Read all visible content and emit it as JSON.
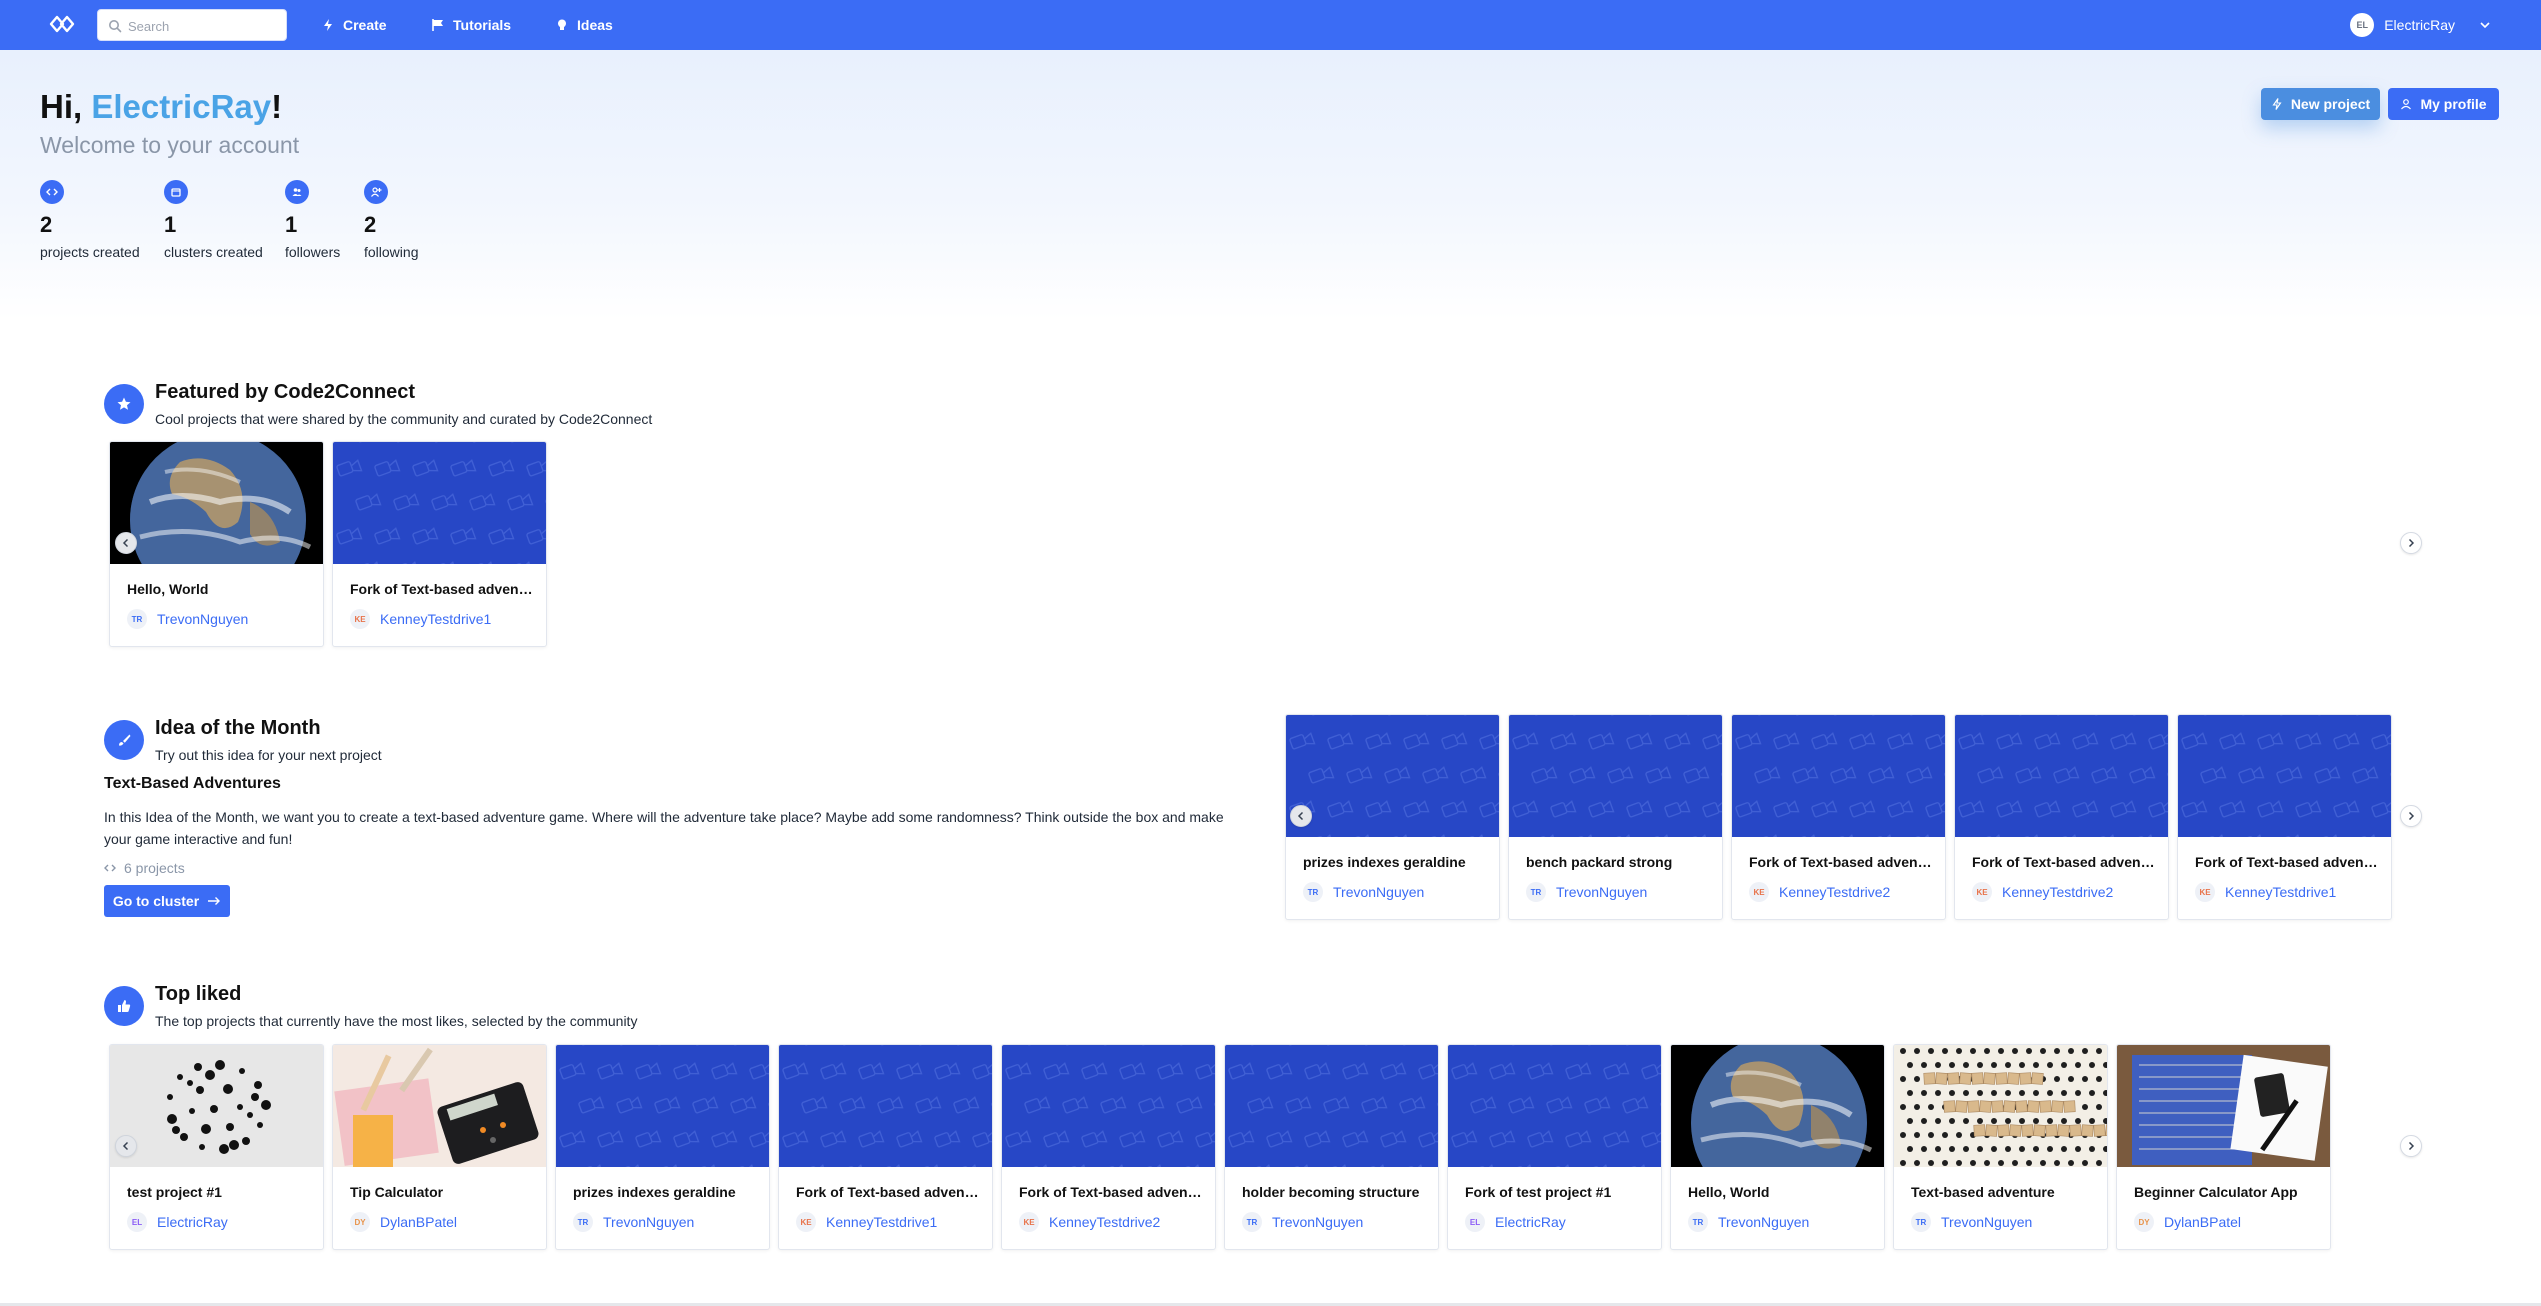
{
  "nav": {
    "search_placeholder": "Search",
    "links": [
      {
        "label": "Create",
        "icon": "bolt-icon"
      },
      {
        "label": "Tutorials",
        "icon": "flag-icon"
      },
      {
        "label": "Ideas",
        "icon": "lightbulb-icon"
      }
    ],
    "user": {
      "initials": "EL",
      "name": "ElectricRay"
    }
  },
  "hero": {
    "greeting_prefix": "Hi, ",
    "username": "ElectricRay",
    "greeting_suffix": "!",
    "welcome": "Welcome to your account",
    "stats": [
      {
        "value": "2",
        "label": "projects created",
        "icon": "code-icon"
      },
      {
        "value": "1",
        "label": "clusters created",
        "icon": "folder-icon"
      },
      {
        "value": "1",
        "label": "followers",
        "icon": "users-icon"
      },
      {
        "value": "2",
        "label": "following",
        "icon": "user-plus-icon"
      }
    ],
    "new_project_label": "New project",
    "my_profile_label": "My profile"
  },
  "featured": {
    "title": "Featured by Code2Connect",
    "subtitle": "Cool projects that were shared by the community and curated by Code2Connect",
    "cards": [
      {
        "title": "Hello, World",
        "initials": "TR",
        "author": "TrevonNguyen",
        "thumb": "earth"
      },
      {
        "title": "Fork of Text-based adventure",
        "initials": "KE",
        "author": "KenneyTestdrive1",
        "thumb": "pattern"
      }
    ]
  },
  "idea": {
    "title": "Idea of the Month",
    "subtitle": "Try out this idea for your next project",
    "idea_title": "Text-Based Adventures",
    "description": "In this Idea of the Month, we want you to create a text-based adventure game. Where will the adventure take place? Maybe add some randomness? Think outside the box and make your game interactive and fun!",
    "count": "6 projects",
    "button_label": "Go to cluster",
    "cards": [
      {
        "title": "prizes indexes geraldine",
        "initials": "TR",
        "author": "TrevonNguyen",
        "thumb": "pattern"
      },
      {
        "title": "bench packard strong",
        "initials": "TR",
        "author": "TrevonNguyen",
        "thumb": "pattern"
      },
      {
        "title": "Fork of Text-based adventure",
        "initials": "KE",
        "author": "KenneyTestdrive2",
        "thumb": "pattern"
      },
      {
        "title": "Fork of Text-based adventure",
        "initials": "KE",
        "author": "KenneyTestdrive2",
        "thumb": "pattern"
      },
      {
        "title": "Fork of Text-based adventure",
        "initials": "KE",
        "author": "KenneyTestdrive1",
        "thumb": "pattern"
      }
    ]
  },
  "top_liked": {
    "title": "Top liked",
    "subtitle": "The top projects that currently have the most likes, selected by the community",
    "cards": [
      {
        "title": "test project #1",
        "initials": "EL",
        "author": "ElectricRay",
        "thumb": "dots"
      },
      {
        "title": "Tip Calculator",
        "initials": "DY",
        "author": "DylanBPatel",
        "thumb": "calculator"
      },
      {
        "title": "prizes indexes geraldine",
        "initials": "TR",
        "author": "TrevonNguyen",
        "thumb": "pattern"
      },
      {
        "title": "Fork of Text-based adventure",
        "initials": "KE",
        "author": "KenneyTestdrive1",
        "thumb": "pattern"
      },
      {
        "title": "Fork of Text-based adventure",
        "initials": "KE",
        "author": "KenneyTestdrive2",
        "thumb": "pattern"
      },
      {
        "title": "holder becoming structure",
        "initials": "TR",
        "author": "TrevonNguyen",
        "thumb": "pattern"
      },
      {
        "title": "Fork of test project #1",
        "initials": "EL",
        "author": "ElectricRay",
        "thumb": "pattern"
      },
      {
        "title": "Hello, World",
        "initials": "TR",
        "author": "TrevonNguyen",
        "thumb": "earth"
      },
      {
        "title": "Text-based adventure",
        "initials": "TR",
        "author": "TrevonNguyen",
        "thumb": "letters"
      },
      {
        "title": "Beginner Calculator App",
        "initials": "DY",
        "author": "DylanBPatel",
        "thumb": "binder"
      }
    ]
  },
  "colors": {
    "primary": "#3b6cf5",
    "username_accent": "#4aa3e6",
    "author_link": "#3b6cf5",
    "avatar_colors": {
      "TR": "#3b6cf5",
      "KE": "#e8734a",
      "EL": "#8b5cf6",
      "DY": "#e8934a"
    }
  }
}
